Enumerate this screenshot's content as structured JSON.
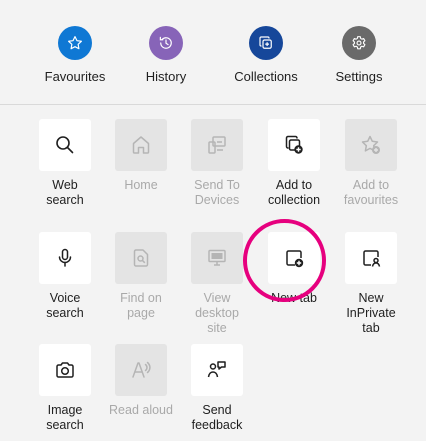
{
  "top": [
    {
      "label": "Favourites",
      "icon": "star-icon",
      "color": "#0f78d4"
    },
    {
      "label": "History",
      "icon": "history-icon",
      "color": "#8764b8"
    },
    {
      "label": "Collections",
      "icon": "collections-icon",
      "color": "#16479a"
    },
    {
      "label": "Settings",
      "icon": "gear-icon",
      "color": "#6a6a6a"
    }
  ],
  "tiles": [
    {
      "label": "Web\nsearch",
      "icon": "search-icon",
      "enabled": true
    },
    {
      "label": "Home",
      "icon": "home-icon",
      "enabled": false
    },
    {
      "label": "Send To\nDevices",
      "icon": "send-to-devices-icon",
      "enabled": false
    },
    {
      "label": "Add to\ncollection",
      "icon": "add-to-collection-icon",
      "enabled": true
    },
    {
      "label": "Add to\nfavourites",
      "icon": "add-to-favourites-icon",
      "enabled": false
    },
    {
      "label": "Voice\nsearch",
      "icon": "microphone-icon",
      "enabled": true
    },
    {
      "label": "Find on\npage",
      "icon": "find-on-page-icon",
      "enabled": false
    },
    {
      "label": "View\ndesktop\nsite",
      "icon": "desktop-icon",
      "enabled": false
    },
    {
      "label": "New tab",
      "icon": "new-tab-icon",
      "enabled": true,
      "highlighted": true
    },
    {
      "label": "New\nInPrivate\ntab",
      "icon": "inprivate-tab-icon",
      "enabled": true
    },
    {
      "label": "Image\nsearch",
      "icon": "camera-icon",
      "enabled": true
    },
    {
      "label": "Read aloud",
      "icon": "read-aloud-icon",
      "enabled": false
    },
    {
      "label": "Send\nfeedback",
      "icon": "feedback-icon",
      "enabled": true
    }
  ],
  "colors": {
    "highlight": "#e6007e",
    "icon_on": "#1f1f1f",
    "icon_off": "#b5b5b5"
  }
}
